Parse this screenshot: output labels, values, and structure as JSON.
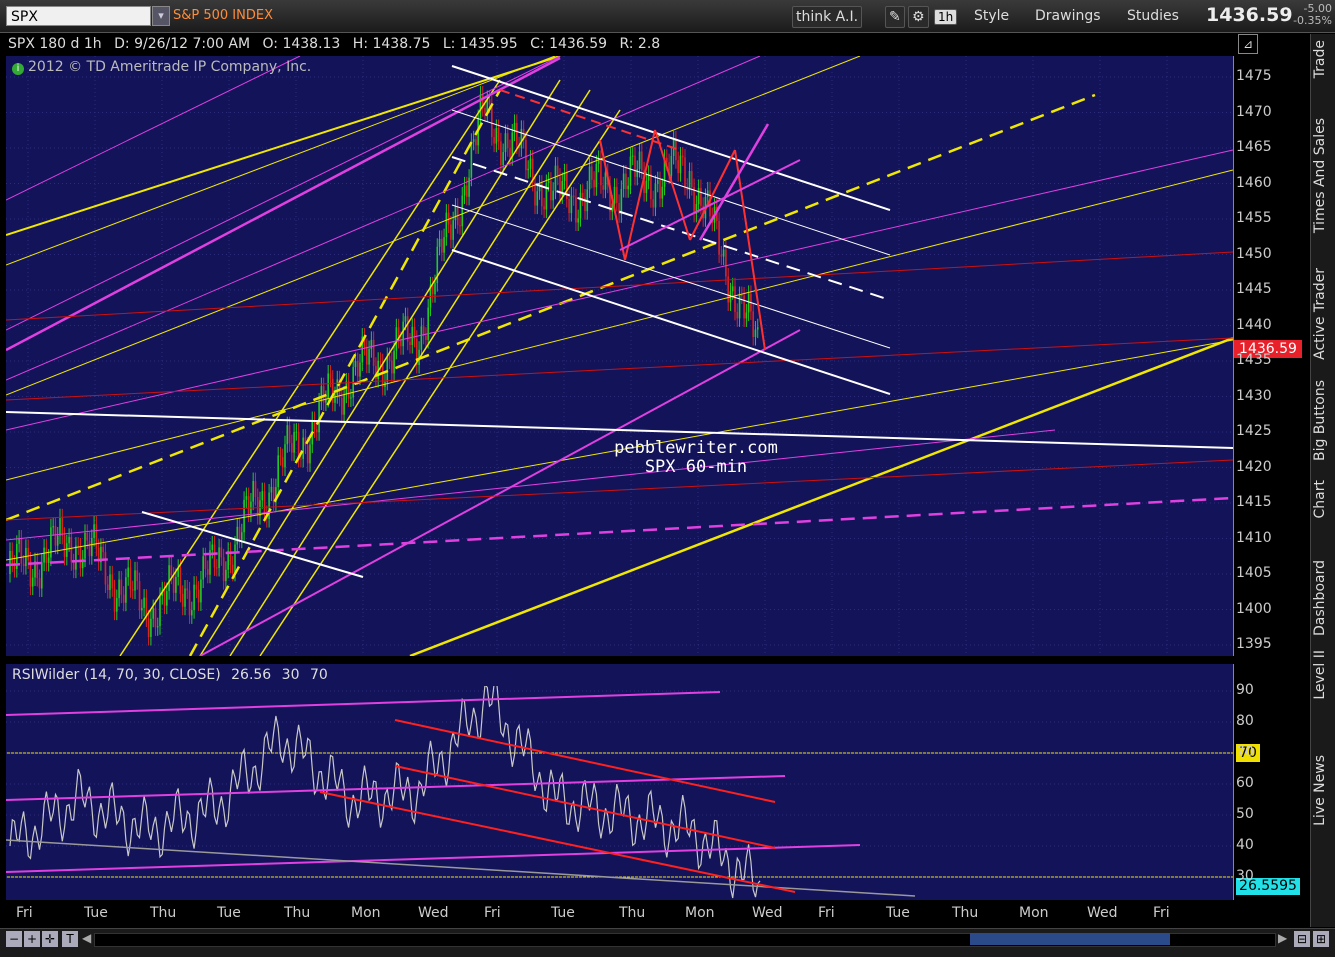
{
  "toolbar": {
    "symbol": "SPX",
    "symbol_desc": "S&P 500 INDEX",
    "think_ai": "think A.I.",
    "timeframe": "1h",
    "style": "Style",
    "drawings": "Drawings",
    "studies": "Studies",
    "last_price": "1436.59",
    "net_change": "-5.00",
    "pct_change": "-0.35%"
  },
  "info": {
    "name": "SPX 180 d 1h",
    "date": "D: 9/26/12 7:00 AM",
    "open": "O: 1438.13",
    "high": "H: 1438.75",
    "low": "L: 1435.95",
    "close": "C: 1436.59",
    "range": "R: 2.8",
    "copyright": "2012 © TD Ameritrade IP Company, Inc."
  },
  "watermark": {
    "line1": "pebblewriter.com",
    "line2": "SPX 60-min"
  },
  "price_axis": {
    "ticks": [
      "1475",
      "1470",
      "1465",
      "1460",
      "1455",
      "1450",
      "1445",
      "1440",
      "1435",
      "1430",
      "1425",
      "1420",
      "1415",
      "1410",
      "1405",
      "1400",
      "1395"
    ],
    "current": "1436.59"
  },
  "rsi": {
    "label": "RSIWilder (14, 70, 30, CLOSE)",
    "value": "26.56",
    "low": "30",
    "high": "70",
    "ticks": [
      "90",
      "80",
      "70",
      "60",
      "50",
      "40",
      "30"
    ],
    "tag70": "70",
    "current": "26.5595"
  },
  "x_axis": [
    "Fri",
    "Tue",
    "Thu",
    "Tue",
    "Thu",
    "Mon",
    "Wed",
    "Fri",
    "Tue",
    "Thu",
    "Mon",
    "Wed",
    "Fri",
    "Tue",
    "Thu",
    "Mon",
    "Wed",
    "Fri"
  ],
  "side_tabs": [
    "Trade",
    "Times And Sales",
    "Active Trader",
    "Big Buttons",
    "Chart",
    "Dashboard",
    "Level II",
    "Live News"
  ],
  "colors": {
    "bg": "#13135a",
    "up": "#22cc22",
    "down": "#dd2222",
    "yellow": "#f0e800",
    "magenta": "#e040e0",
    "white": "#ffffff",
    "red": "#cc1111"
  },
  "chart_data": {
    "type": "line",
    "title": "SPX 180 d 1h",
    "ylim": [
      1392,
      1478
    ],
    "x": [
      "Fri",
      "Tue",
      "Thu",
      "Tue",
      "Thu",
      "Mon",
      "Wed",
      "Fri",
      "Tue",
      "Thu",
      "Mon",
      "Wed"
    ],
    "series": [
      {
        "name": "SPX",
        "values": [
          1405,
          1410,
          1400,
          1405,
          1420,
          1433,
          1438,
          1470,
          1458,
          1460,
          1462,
          1436.59
        ]
      },
      {
        "name": "RSIWilder",
        "values": [
          40,
          55,
          45,
          52,
          75,
          55,
          58,
          88,
          55,
          50,
          45,
          26.56
        ]
      }
    ]
  }
}
